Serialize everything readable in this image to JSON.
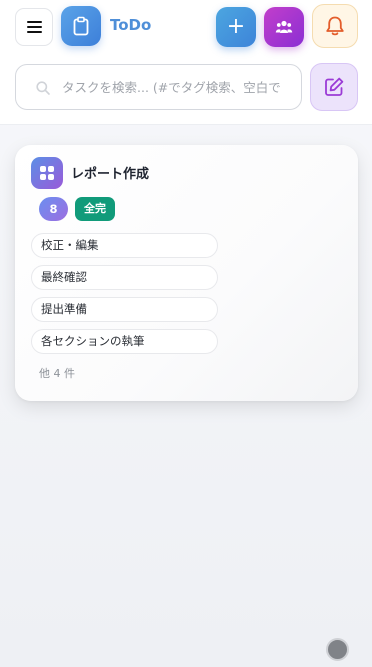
{
  "header": {
    "app_title": "ToDo",
    "add_label": "+",
    "icons": {
      "menu": "menu-icon",
      "logo": "clipboard-icon",
      "team": "users-icon",
      "notifications": "bell-icon"
    }
  },
  "search": {
    "placeholder": "タスクを検索... (#でタグ検索、空白で",
    "value": "",
    "icon": "search-icon"
  },
  "edit_button": {
    "icon": "pencil-square-icon"
  },
  "card": {
    "title": "レポート作成",
    "icon": "grid-icon",
    "count": "8",
    "status": "全完",
    "tasks": [
      "校正・編集",
      "最終確認",
      "提出準備",
      "各セクションの執筆"
    ],
    "more": "他 4 件"
  },
  "colors": {
    "accent_blue": "#4f8fd8",
    "team_purple": "#a236cf",
    "status_green": "#119b7a",
    "edit_bg": "#ece3fb"
  }
}
